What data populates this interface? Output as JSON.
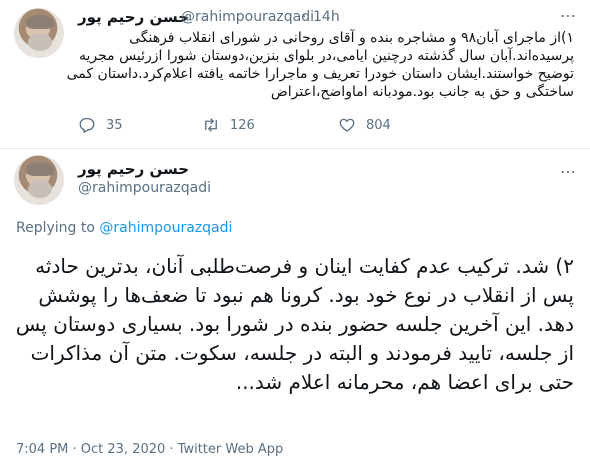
{
  "tweet1": {
    "display_name": "حسن رحیم پور",
    "handle": "@rahimpourazqadi",
    "separator": "·",
    "time": "14h",
    "text": "۱)از ماجرای آبان۹۸ و مشاجره بنده و آقای روحانی در شورای انقلاب فرهنگی پرسیده‌اند.آبان سال گذشته درچنین ایامی،در بلوای بنزین،دوستان شورا ازرئیس مجریه توضیح خواستند.ایشان داستان خودرا تعریف و ماجرارا خاتمه یافته اعلام‌کرد.داستان کمی ساختگی و حق به جانب بود.مودبانه اماواضح،اعتراض",
    "replies": "35",
    "retweets": "126",
    "likes": "804"
  },
  "tweet2": {
    "display_name": "حسن رحیم پور",
    "handle": "@rahimpourazqadi",
    "replying_prefix": "Replying to",
    "replying_to": "@rahimpourazqadi",
    "text": "۲) شد. ترکیب عدم کفایت اینان و فرصت‌طلبی آنان، بدترین حادثه پس از انقلاب در نوع خود بود. کرونا هم نبود تا ضعف‌ها را پوشش دهد. این آخرین جلسه حضور بنده در شورا بود. بسیاری دوستان پس از جلسه، تایید فرمودند و البته در جلسه، سکوت. متن آن مذاکرات حتی برای اعضا هم، محرمانه اعلام شد...",
    "timestamp": "7:04 PM · Oct 23, 2020 · Twitter Web App"
  },
  "icons": [
    "avatar",
    "more-icon",
    "reply-icon",
    "retweet-icon",
    "like-icon"
  ],
  "colors": {
    "secondary_text": "#5b7083",
    "link": "#1b95e0",
    "divider": "#e6ecf0"
  }
}
